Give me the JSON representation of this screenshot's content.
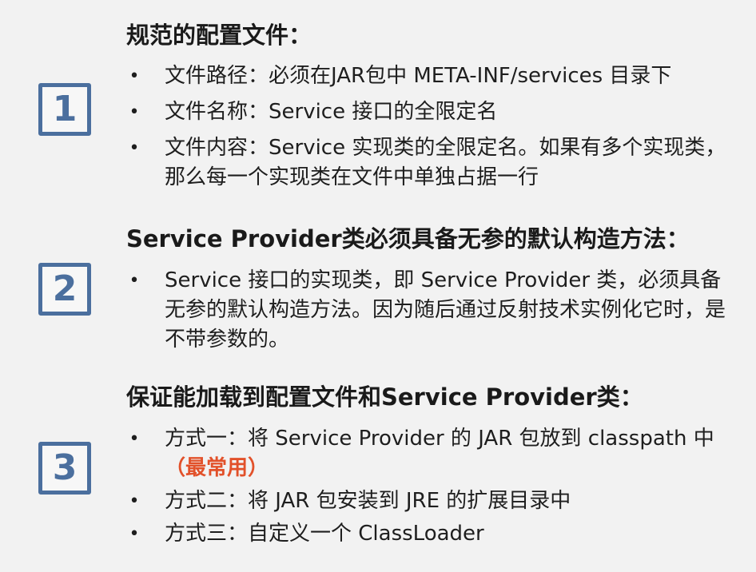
{
  "sections": [
    {
      "number": "1",
      "heading": "规范的配置文件：",
      "bullets": [
        "文件路径：必须在JAR包中 META-INF/services 目录下",
        "文件名称：Service 接口的全限定名",
        "文件内容：Service 实现类的全限定名。如果有多个实现类，那么每一个实现类在文件中单独占据一行"
      ]
    },
    {
      "number": "2",
      "heading": "Service Provider类必须具备无参的默认构造方法：",
      "bullets": [
        "Service 接口的实现类，即 Service Provider 类，必须具备无参的默认构造方法。因为随后通过反射技术实例化它时，是不带参数的。"
      ]
    },
    {
      "number": "3",
      "heading": "保证能加载到配置文件和Service Provider类：",
      "bullets": [
        "方式一：将 Service Provider 的 JAR 包放到 classpath 中",
        "方式二：将 JAR 包安装到 JRE 的扩展目录中",
        "方式三：自定义一个 ClassLoader"
      ],
      "emphasis": "（最常用）"
    }
  ],
  "bullet_symbol": "•",
  "colors": {
    "box_border": "#4b6f9e",
    "emphasis": "#e2512a",
    "background": "#f2f2f2"
  }
}
